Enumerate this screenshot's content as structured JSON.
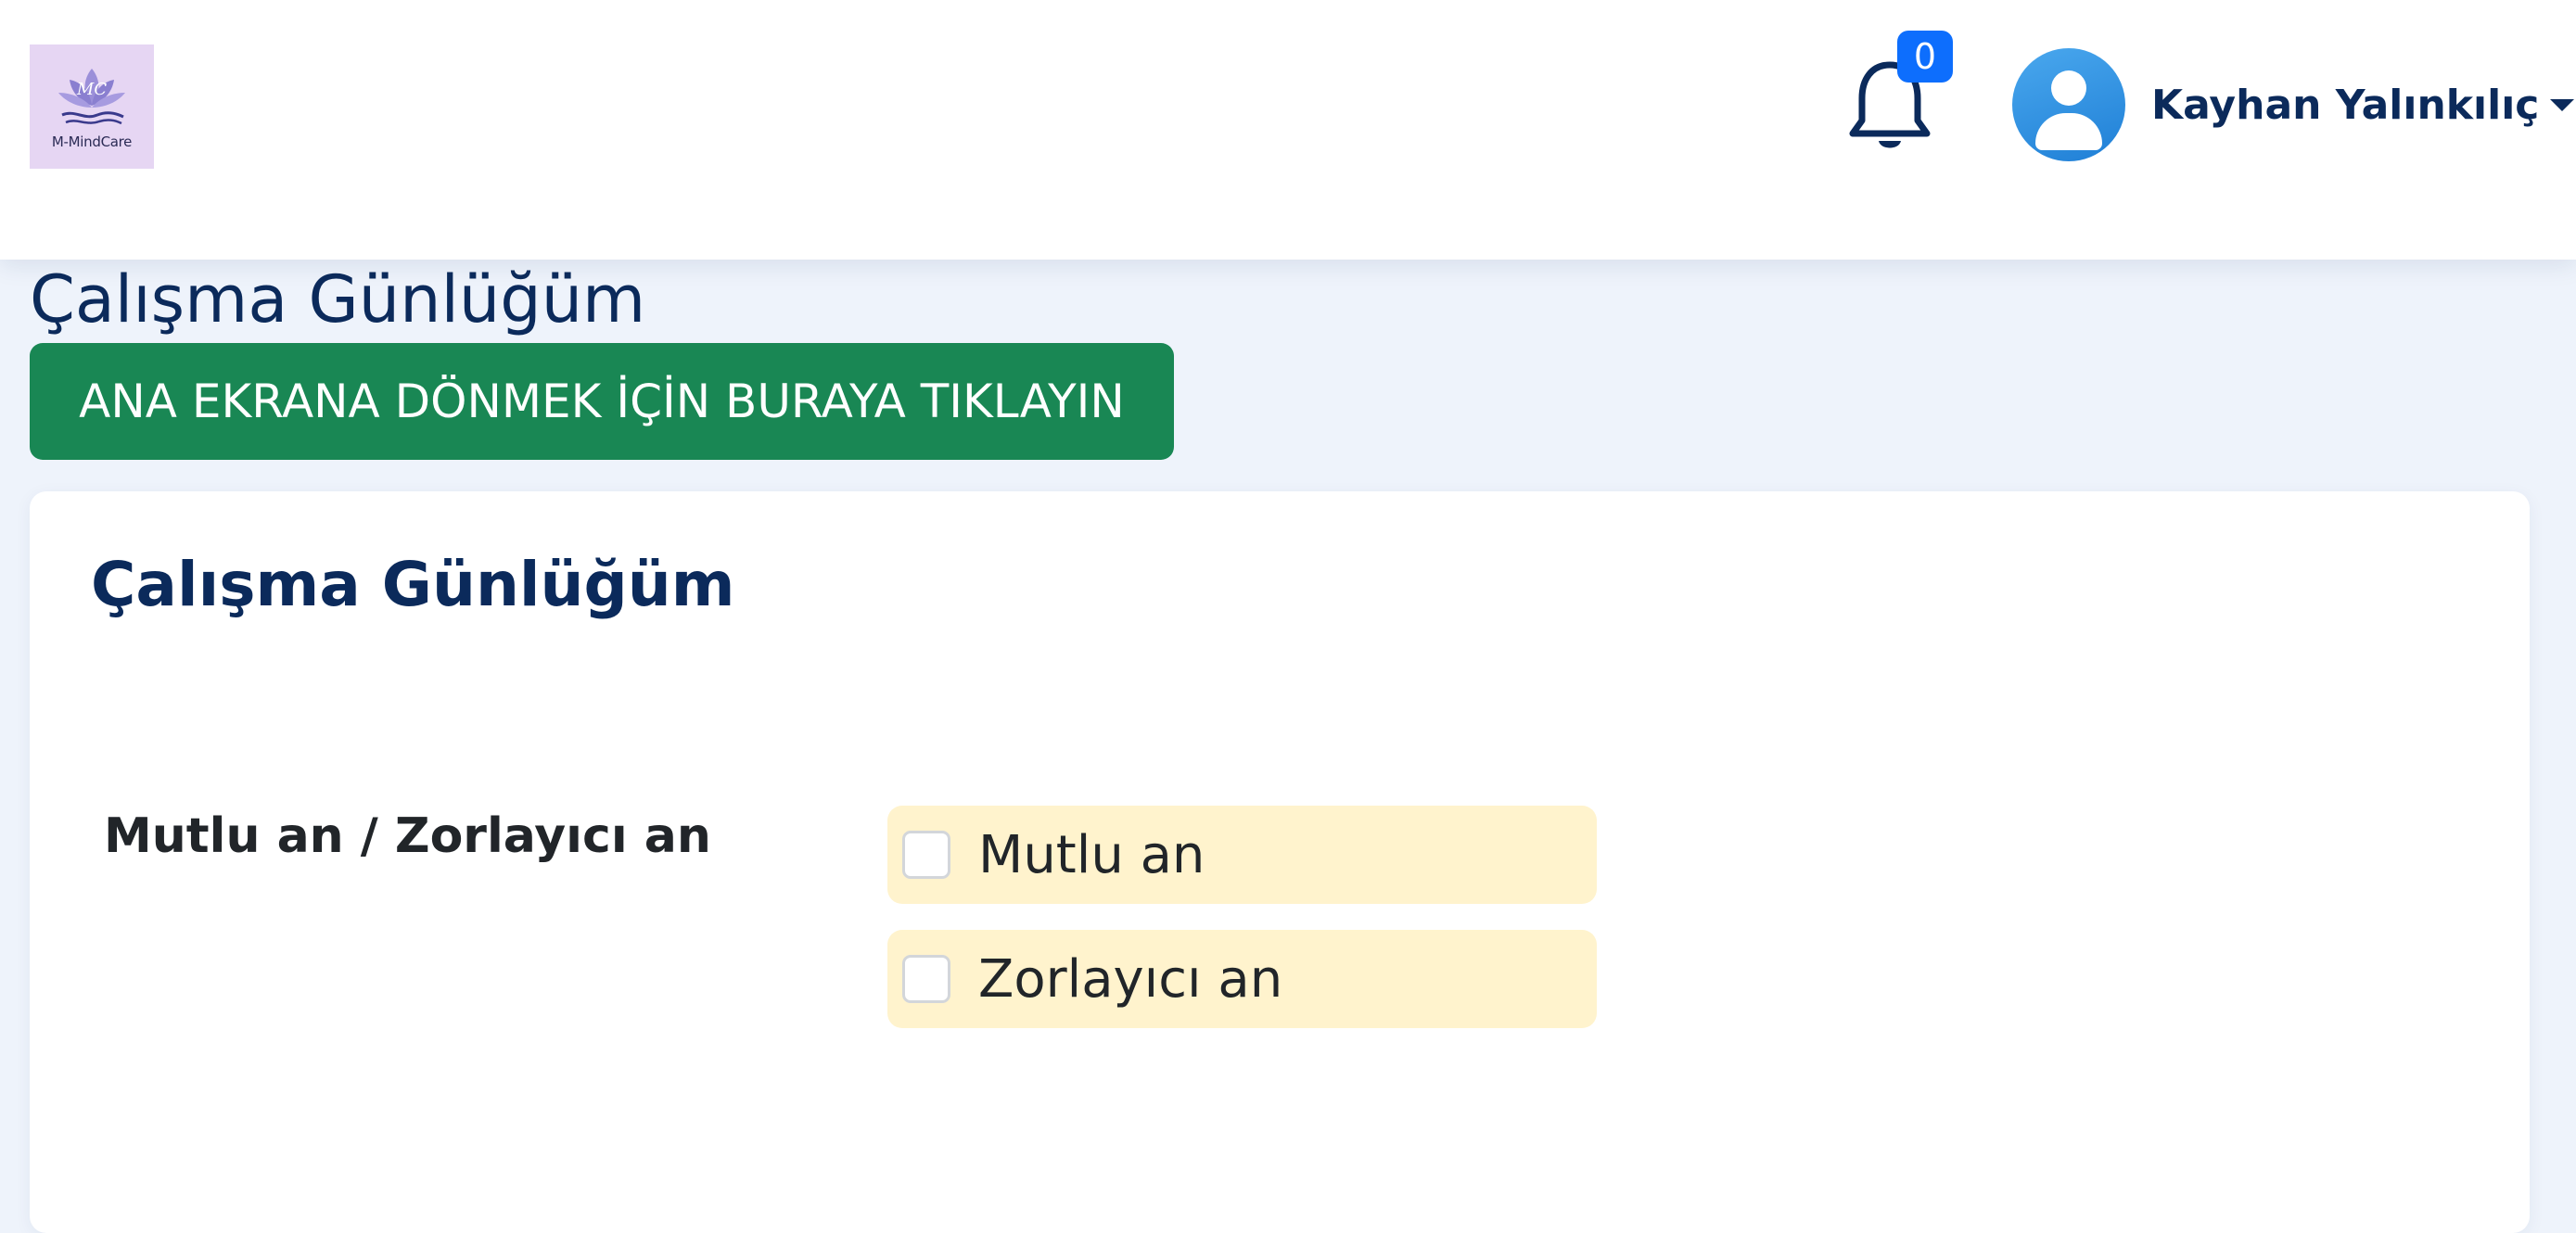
{
  "header": {
    "logo": {
      "text": "M-MindCare",
      "monogram": "MC",
      "icon": "lotus-logo-icon"
    },
    "notifications": {
      "icon": "bell-icon",
      "count": "0",
      "badge_color": "#0d6efd"
    },
    "user": {
      "name": "Kayhan Yalınkılıç",
      "avatar_icon": "user-avatar-icon",
      "dropdown_icon": "caret-down-icon"
    }
  },
  "page": {
    "title": "Çalışma Günlüğüm",
    "home_button_label": "ANA EKRANA DÖNMEK İÇİN BURAYA TIKLAYIN",
    "home_button_color": "#198754"
  },
  "card": {
    "title": "Çalışma Günlüğüm",
    "field": {
      "label": "Mutlu an / Zorlayıcı an",
      "options": [
        {
          "label": "Mutlu an",
          "checked": false
        },
        {
          "label": "Zorlayıcı an",
          "checked": false
        }
      ],
      "option_bg": "#fff3cd"
    }
  },
  "colors": {
    "text_primary": "#0b2a5b",
    "background": "#eef3fb"
  }
}
